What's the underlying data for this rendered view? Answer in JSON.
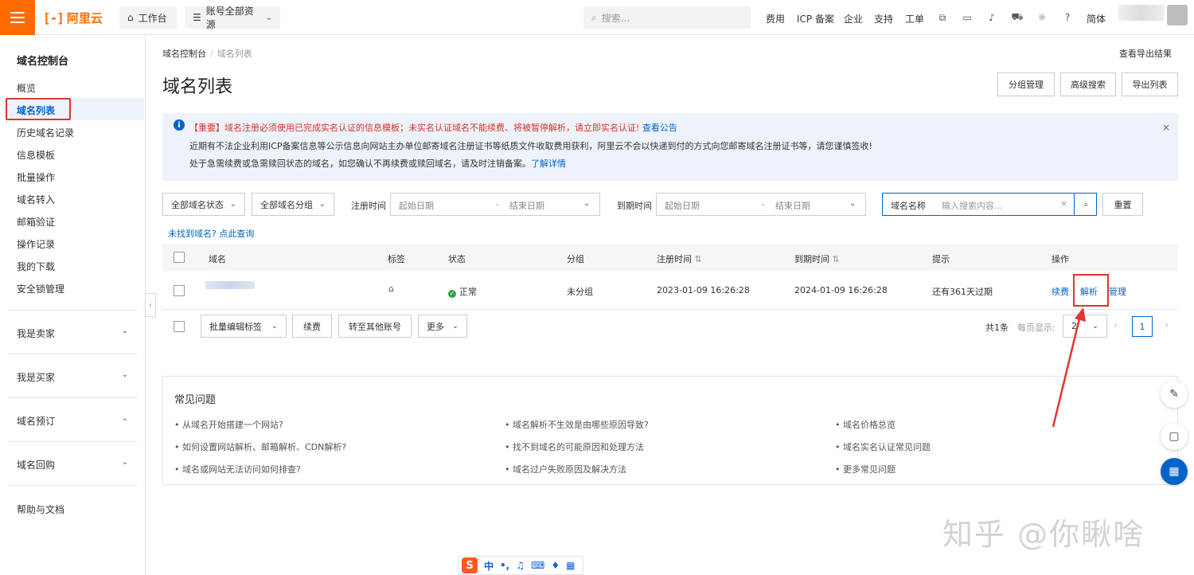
{
  "topbar": {
    "brand": "阿里云",
    "brand_mark": "[-]",
    "workbench": "工作台",
    "resources": "账号全部资源",
    "search_placeholder": "搜索...",
    "links": [
      "费用",
      "ICP 备案",
      "企业",
      "支持",
      "工单"
    ],
    "lang": "简体"
  },
  "sidebar": {
    "title": "域名控制台",
    "items": [
      "概览",
      "域名列表",
      "历史域名记录",
      "信息模板",
      "批量操作",
      "域名转入",
      "邮箱验证",
      "操作记录",
      "我的下载",
      "安全锁管理"
    ],
    "groups": [
      "我是卖家",
      "我是买家",
      "域名预订",
      "域名回购"
    ],
    "help": "帮助与文档"
  },
  "breadcrumb": {
    "root": "域名控制台",
    "sep": "/",
    "current": "域名列表"
  },
  "export_result": "查看导出结果",
  "page_title": "域名列表",
  "actions": {
    "group_manage": "分组管理",
    "advanced_search": "高级搜索",
    "export_list": "导出列表"
  },
  "notice": {
    "line1": "【重要】域名注册必须使用已完成实名认证的信息模板；未实名认证域名不能续费、将被暂停解析，请立即实名认证!",
    "line1_link": "查看公告",
    "line2": "近期有不法企业利用ICP备案信息等公示信息向网站主办单位邮寄域名注册证书等纸质文件收取费用获利，阿里云不会以快递到付的方式向您邮寄域名注册证书等，请您谨慎签收!",
    "line3": "处于急需续费或急需赎回状态的域名，如您确认不再续费或赎回域名，请及时注销备案。",
    "line3_link": "了解详情"
  },
  "filters": {
    "status": "全部域名状态",
    "group": "全部域名分组",
    "reg_time_label": "注册时间",
    "exp_time_label": "到期时间",
    "start_date": "起始日期",
    "end_date": "结束日期",
    "range_sep": "-",
    "search_label": "域名名称",
    "search_placeholder": "输入搜索内容...",
    "reset": "重置"
  },
  "not_found_link": "未找到域名? 点此查询",
  "table": {
    "headers": [
      "域名",
      "标签",
      "状态",
      "分组",
      "注册时间",
      "到期时间",
      "提示",
      "操作"
    ],
    "sort_glyph": "⇅",
    "rows": [
      {
        "status": "正常",
        "group": "未分组",
        "reg_time": "2023-01-09 16:26:28",
        "exp_time": "2024-01-09 16:26:28",
        "hint": "还有361天过期",
        "ops": [
          "续费",
          "解析",
          "管理"
        ]
      }
    ]
  },
  "bulk": {
    "edit_tags": "批量编辑标签",
    "renew": "续费",
    "transfer": "转至其他账号",
    "more": "更多"
  },
  "pagination": {
    "total": "共1条",
    "per_page_label": "每页显示:",
    "per_page_value": "2",
    "current_page": "1"
  },
  "faq": {
    "title": "常见问题",
    "items": [
      "• 从域名开始搭建一个网站?",
      "• 域名解析不生效是由哪些原因导致?",
      "• 域名价格总览",
      "• 如何设置网站解析、邮箱解析、CDN解析?",
      "• 找不到域名的可能原因和处理方法",
      "• 域名实名认证常见问题",
      "• 域名或网站无法访问如何排查?",
      "• 域名过户失败原因及解决方法",
      "• 更多常见问题"
    ]
  },
  "watermark": "知乎 @你瞅啥",
  "ime": {
    "logo": "S",
    "mode": "中",
    "punct": "•,"
  },
  "colors": {
    "brand": "#ff6a00",
    "link": "#0064c8",
    "highlight": "#e0342d",
    "ok": "#2fa14a"
  }
}
